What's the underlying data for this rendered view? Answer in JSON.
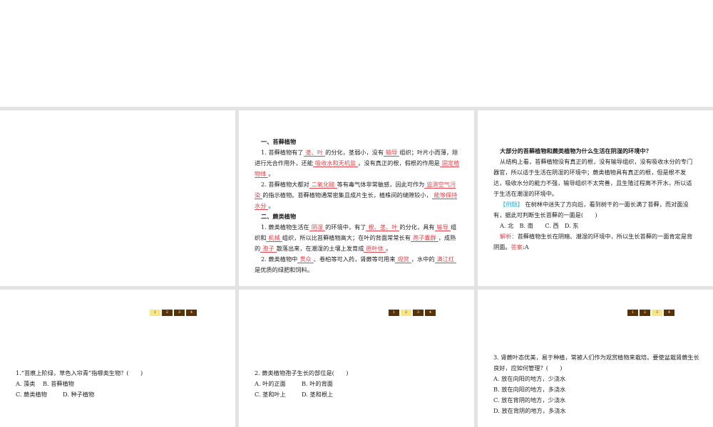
{
  "slide2": {
    "h1": "一、苔藓植物",
    "p1a": "1. 苔藓植物有了",
    "a1": "茎、叶",
    "p1b": "的分化，茎弱小，没有",
    "a2": "输导",
    "p1c": "组织；叶片小而薄，除进行光合作用外，还能",
    "a3": "吸收水和无机盐",
    "p1d": "。没有真正的根，假根的作用是",
    "a4": "固定植物体",
    "p1e": "。",
    "p2a": "2. 苔藓植物大都对",
    "a5": "二氧化硫",
    "p2b": "等有毒气体非常敏感，因此可作为",
    "a6": "监测空气污染",
    "p2c": "的指示植物。苔藓植物通常密集且成片生长，植株间的缝隙较小，",
    "a7": "能够保持水分",
    "p2d": "。",
    "h2": "二、蕨类植物",
    "p3a": "1. 蕨类植物生活在",
    "a8": "阴湿",
    "p3b": "的环境中，有了",
    "a9": "根、茎、叶",
    "p3c": "的分化，具有",
    "a10": "输导",
    "p3d": "组织和",
    "a11": "机械",
    "p3e": "组织，所以比苔藓植物高大；在叶的背面常常长有",
    "a12": "孢子囊群",
    "p3f": "，成熟的",
    "a13": "孢子",
    "p3g": "散落出来，在潮湿的土壤上发育成",
    "a14": "原叶体",
    "p3h": "。",
    "p4a": "2. 蕨类植物中",
    "a15": "贯众",
    "p4b": "、卷柏等可入药，肾蕨等可用来",
    "a16": "观赏",
    "p4c": "，水中的",
    "a17": "满江红",
    "p4d": "是优质的绿肥和饲料。"
  },
  "slide3": {
    "q": "大部分的苔藓植物和蕨类植物为什么生活在阴湿的环境中？",
    "ans": "从结构上看，苔藓植物没有真正的根，没有输导组织，没有吸收水分的专门器官，所以适于生活在阴湿的环境中；蕨类植物具有真正的根，但是根不发达，吸收水分的能力不强，输导组织不太完善，且生殖过程离不开水，所以适于生活在潮湿的环境中。",
    "tag": "【例题】",
    "ex": "在树林中迷失了方向后，看到树干的一面长满了苔藓，而对面没有，据此可判断生长苔藓的一面是(　　)",
    "opts": "A. 北　B. 南　　C. 西　D. 东",
    "jx": "解析：",
    "jxt": "苔藓植物生长在阴暗、潮湿的环境中，所以生长苔藓的一面肯定是背阴面。",
    "da": "答案",
    "dat": ":A"
  },
  "nav": [
    "1",
    "2",
    "3",
    "4"
  ],
  "q1": {
    "stem": "1.“苔痕上阶绿，草色入帘青”指哪类生物？(　　)",
    "a": "A. 藻类",
    "b": "B. 苔藓植物",
    "c": "C. 蕨类植物",
    "d": "D. 种子植物"
  },
  "q2": {
    "stem": "2. 蕨类植物孢子生长的部位是(　　)",
    "a": "A. 叶的正面",
    "b": "B. 叶的背面",
    "c": "C. 茎和叶上",
    "d": "D. 茎和根上"
  },
  "q3": {
    "stem": "3. 肾蕨叶态优美，易于种植，常被人们作为观赏植物来栽培。要使盆栽肾蕨生长良好，应如何管理？(　　)",
    "a": "A. 放在向阳的地方，少浇水",
    "b": "B. 放在向阳的地方，多浇水",
    "c": "C. 放在背阴的地方，少浇水",
    "d": "D. 放在背阴的地方，多浇水"
  }
}
